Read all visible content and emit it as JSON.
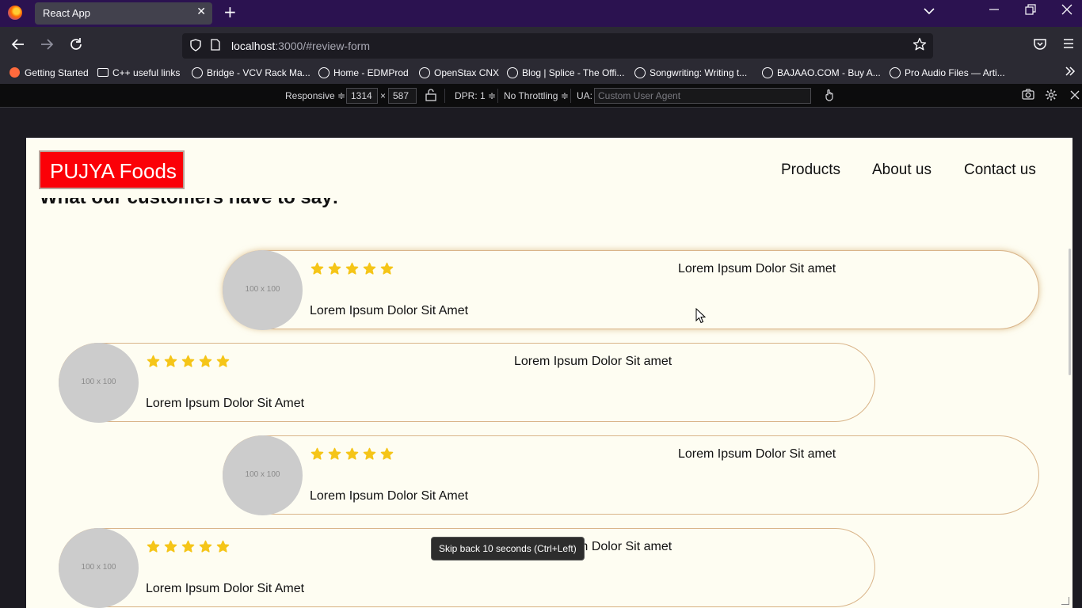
{
  "browser": {
    "tab_title": "React App",
    "tab_close": "✕",
    "new_tab": "+",
    "url_host": "localhost",
    "url_rest": ":3000/#review-form",
    "bookmarks": [
      {
        "label": "Getting Started",
        "icon": "firefox-icon"
      },
      {
        "label": "C++ useful links",
        "icon": "folder-icon"
      },
      {
        "label": "Bridge - VCV Rack Ma...",
        "icon": "globe-icon"
      },
      {
        "label": "Home - EDMProd",
        "icon": "globe-icon"
      },
      {
        "label": "OpenStax CNX",
        "icon": "globe-icon"
      },
      {
        "label": "Blog | Splice - The Offi...",
        "icon": "globe-icon"
      },
      {
        "label": "Songwriting: Writing t...",
        "icon": "globe-icon"
      },
      {
        "label": "BAJAAO.COM - Buy A...",
        "icon": "globe-icon"
      },
      {
        "label": "Pro Audio Files — Arti...",
        "icon": "globe-icon"
      }
    ]
  },
  "responsive_toolbar": {
    "device": "Responsive ≑",
    "width": "1314",
    "times": "×",
    "height": "587",
    "dpr": "DPR: 1 ≑",
    "throttling": "No Throttling ≑",
    "ua_label": "UA:",
    "ua_placeholder": "Custom User Agent"
  },
  "site": {
    "brand": "PUJYA Foods",
    "nav": [
      "Products",
      "About us",
      "Contact us"
    ],
    "section_heading": "What our customers have to say:"
  },
  "reviews": [
    {
      "avatar": "100 x 100",
      "rating": 5,
      "title": "Lorem Ipsum Dolor Sit amet",
      "body": "Lorem Ipsum Dolor Sit Amet"
    },
    {
      "avatar": "100 x 100",
      "rating": 5,
      "title": "Lorem Ipsum Dolor Sit amet",
      "body": "Lorem Ipsum Dolor Sit Amet"
    },
    {
      "avatar": "100 x 100",
      "rating": 5,
      "title": "Lorem Ipsum Dolor Sit amet",
      "body": "Lorem Ipsum Dolor Sit Amet"
    },
    {
      "avatar": "100 x 100",
      "rating": 5,
      "title": "Lorem Ipsum Dolor Sit amet",
      "body": "Lorem Ipsum Dolor Sit Amet"
    }
  ],
  "tooltip": "Skip back 10 seconds (Ctrl+Left)",
  "colors": {
    "brand_red": "#fb0007",
    "star": "#f5c518",
    "card_border": "#d9b489",
    "page_bg": "#fefdf2"
  }
}
